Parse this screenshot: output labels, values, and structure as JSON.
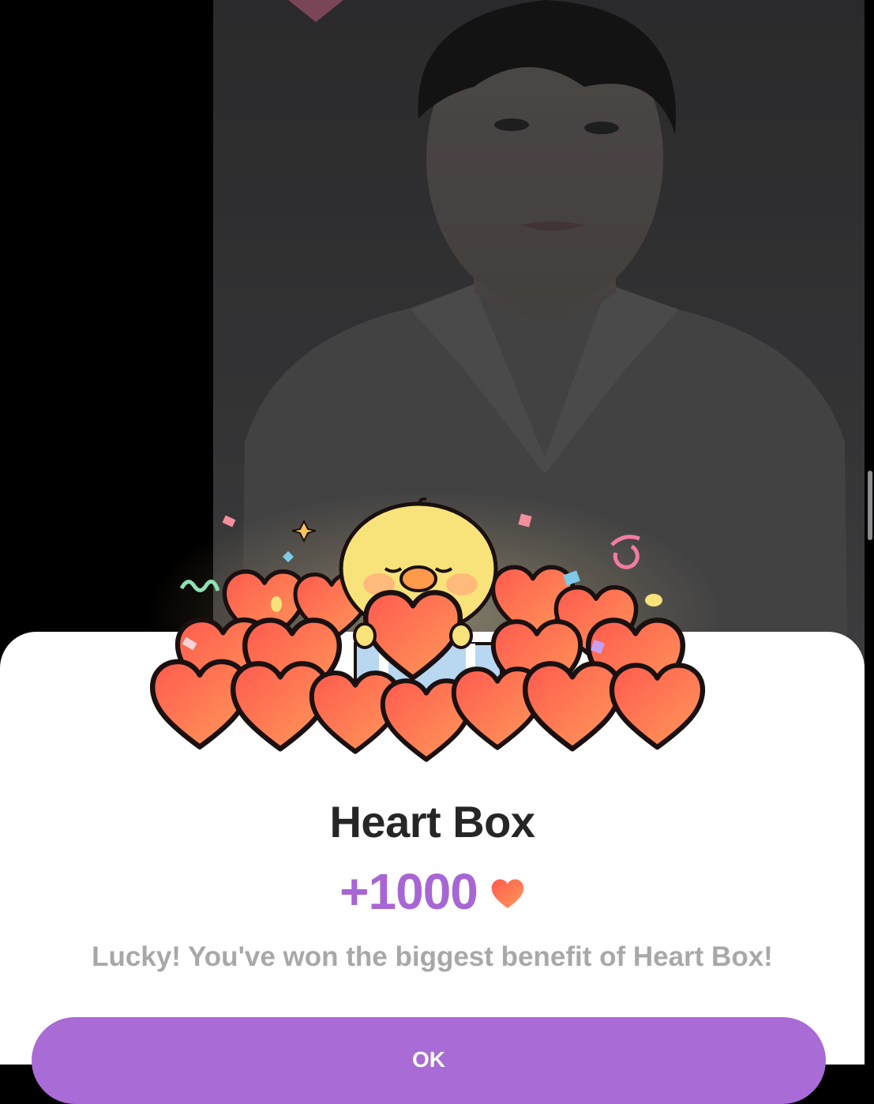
{
  "background": {
    "photo_description_icon": "person-photo",
    "overlay_color": "#000000"
  },
  "modal": {
    "title": "Heart Box",
    "reward_amount": "+1000",
    "reward_icon": "heart-icon",
    "message": "Lucky! You've won the biggest benefit of Heart Box!",
    "ok_label": "OK",
    "accent_color": "#a96bd6",
    "title_color": "#262626"
  },
  "illustration": {
    "icon": "chick-with-hearts-icon"
  }
}
